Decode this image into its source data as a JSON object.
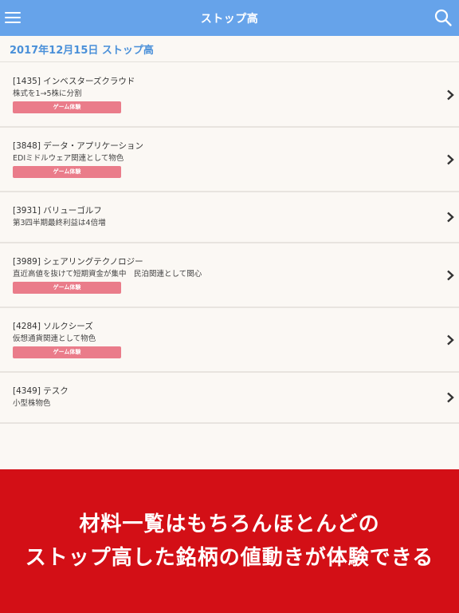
{
  "header": {
    "title": "ストップ高"
  },
  "date_header": "2017年12月15日 ストップ高",
  "items": [
    {
      "name": "[1435] インベスターズクラウド",
      "desc": "株式を1→5株に分割",
      "button": "ゲーム体験"
    },
    {
      "name": "[3848] データ・アプリケーション",
      "desc": "EDIミドルウェア関連として物色",
      "button": "ゲーム体験"
    },
    {
      "name": "[3931] バリューゴルフ",
      "desc": "第3四半期最終利益は4倍増",
      "button": null
    },
    {
      "name": "[3989] シェアリングテクノロジー",
      "desc": "直近高値を抜けて短期資金が集中　民泊関連として関心",
      "button": "ゲーム体験"
    },
    {
      "name": "[4284] ソルクシーズ",
      "desc": "仮想通貨関連として物色",
      "button": "ゲーム体験"
    },
    {
      "name": "[4349] テスク",
      "desc": "小型株物色",
      "button": null
    }
  ],
  "banner": {
    "line1": "材料一覧はもちろんほとんどの",
    "line2": "ストップ高した銘柄の値動きが体験できる"
  },
  "colors": {
    "topbar": "#66a3ea",
    "accent": "#4a90d9",
    "button": "#ea7c8a",
    "banner": "#d30f16"
  },
  "icons": {
    "menu": "menu-icon",
    "search": "search-icon",
    "chevron": "chevron-right-icon"
  }
}
